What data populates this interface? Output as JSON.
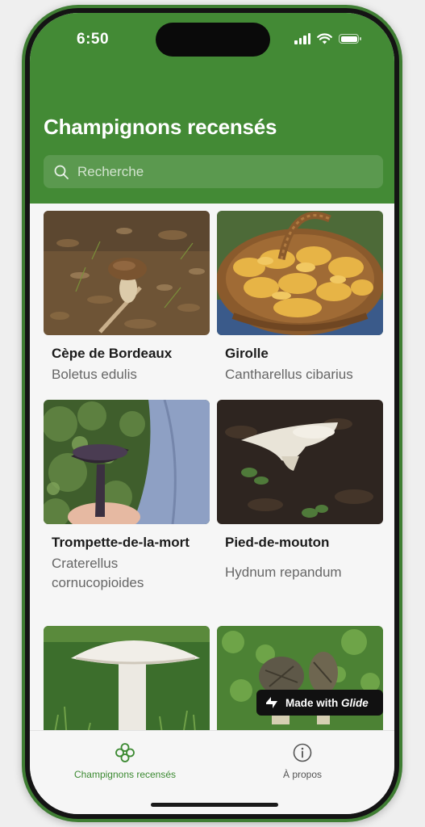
{
  "status_bar": {
    "time": "6:50"
  },
  "header": {
    "title": "Champignons recensés",
    "search": {
      "placeholder": "Recherche",
      "value": ""
    }
  },
  "cards": [
    {
      "name": "Cèpe de Bordeaux",
      "latin": "Boletus edulis",
      "image": "porcini-mushroom-photo"
    },
    {
      "name": "Girolle",
      "latin": "Cantharellus cibarius",
      "image": "chanterelle-basket-photo"
    },
    {
      "name": "Trompette-de-la-mort",
      "latin": "Craterellus cornucopioides",
      "image": "black-trumpet-photo"
    },
    {
      "name": "Pied-de-mouton",
      "latin": "Hydnum repandum",
      "image": "hedgehog-mushroom-photo"
    },
    {
      "name": "",
      "latin": "",
      "image": "white-mushroom-photo"
    },
    {
      "name": "",
      "latin": "",
      "image": "morel-photo"
    }
  ],
  "badge": {
    "text": "Made with",
    "brand": "Glide"
  },
  "tabs": [
    {
      "label": "Champignons recensés",
      "icon": "mushroom-cluster-icon",
      "active": true
    },
    {
      "label": "À propos",
      "icon": "info-circle-icon",
      "active": false
    }
  ],
  "colors": {
    "primary_green": "#438a35",
    "frame_green": "#3f7e33",
    "tab_active": "#3c8a32",
    "tab_inactive": "#555555"
  }
}
